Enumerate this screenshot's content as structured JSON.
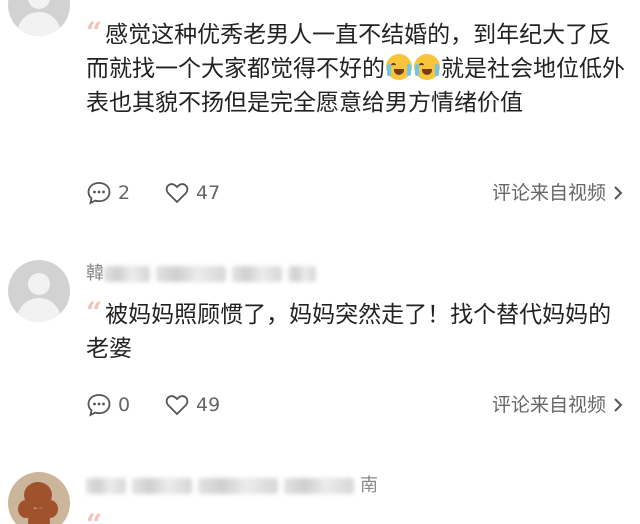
{
  "comments": [
    {
      "text_before_emoji": "感觉这种优秀老男人一直不结婚的，到年纪大了反而就找一个大家都觉得不好的",
      "text_after_emoji": "就是社会地位低外表也其貌不扬但是完全愿意给男方情绪价值",
      "reply_count": "2",
      "like_count": "47",
      "source_link": "评论来自视频"
    },
    {
      "username_partial": "韓",
      "text": "被妈妈照顾惯了，妈妈突然走了！找个替代妈妈的老婆",
      "reply_count": "0",
      "like_count": "49",
      "source_link": "评论来自视频"
    },
    {
      "meta_partial": "南"
    }
  ],
  "icons": {
    "quote": "quote-mark-icon",
    "reply": "comment-bubble-icon",
    "like": "heart-icon",
    "chevron": "chevron-right-icon",
    "emoji": "crying-laughing-emoji"
  },
  "colors": {
    "quote_mark": "#f2c1b8",
    "text": "#222222",
    "secondary": "#666666",
    "emoji": "#f7c53b"
  }
}
